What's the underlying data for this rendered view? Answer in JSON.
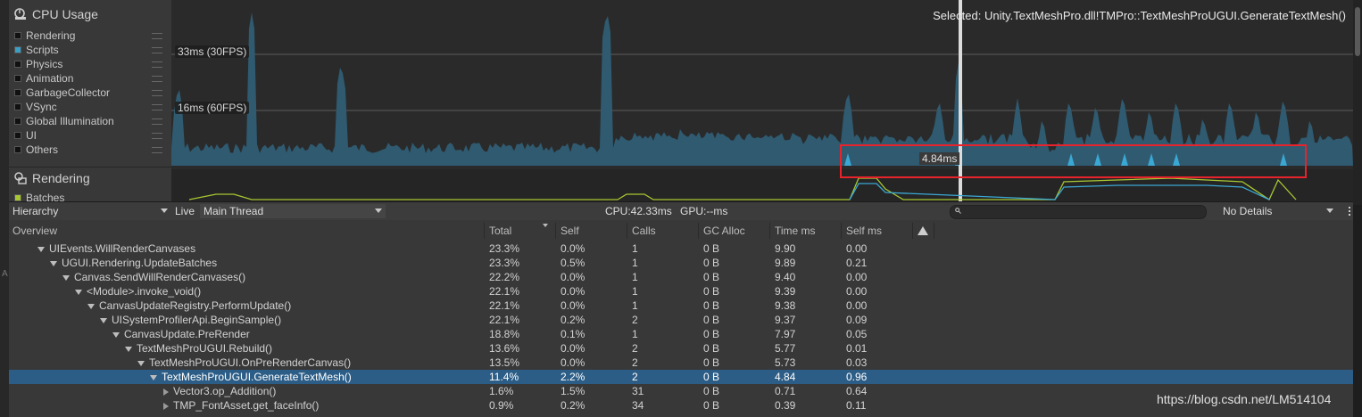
{
  "modules": {
    "cpu": {
      "title": "CPU Usage",
      "legend": [
        {
          "label": "Rendering",
          "color": "#111111"
        },
        {
          "label": "Scripts",
          "color": "#3a9fc4"
        },
        {
          "label": "Physics",
          "color": "#111111"
        },
        {
          "label": "Animation",
          "color": "#111111"
        },
        {
          "label": "GarbageCollector",
          "color": "#111111"
        },
        {
          "label": "VSync",
          "color": "#111111"
        },
        {
          "label": "Global Illumination",
          "color": "#111111"
        },
        {
          "label": "UI",
          "color": "#111111"
        },
        {
          "label": "Others",
          "color": "#111111"
        }
      ]
    },
    "rendering": {
      "title": "Rendering",
      "legend_first": "Batches",
      "legend_color": "#a8c832"
    }
  },
  "chart": {
    "selected": "Selected: Unity.TextMeshPro.dll!TMPro::TextMeshProUGUI.GenerateTextMesh()",
    "line_33": "33ms (30FPS)",
    "line_16": "16ms (60FPS)",
    "marker_value": "4.84ms",
    "colors": {
      "area": "#2f5a70",
      "bars": "#3ba8d4",
      "cursor": "#dcdcdc",
      "highlight": "#e8232b"
    }
  },
  "toolbar": {
    "view": "Hierarchy",
    "live": "Live",
    "thread": "Main Thread",
    "cpu": "CPU:42.33ms",
    "gpu": "GPU:--ms",
    "details": "No Details"
  },
  "table": {
    "headers": {
      "overview": "Overview",
      "total": "Total",
      "self": "Self",
      "calls": "Calls",
      "gc": "GC Alloc",
      "time": "Time ms",
      "selfms": "Self ms"
    },
    "rows": [
      {
        "name": "UIEvents.WillRenderCanvases",
        "depth": 0,
        "expanded": true,
        "total": "23.3%",
        "self": "0.0%",
        "calls": "1",
        "gc": "0 B",
        "time": "9.90",
        "selfms": "0.00"
      },
      {
        "name": "UGUI.Rendering.UpdateBatches",
        "depth": 1,
        "expanded": true,
        "total": "23.3%",
        "self": "0.5%",
        "calls": "1",
        "gc": "0 B",
        "time": "9.89",
        "selfms": "0.21"
      },
      {
        "name": "Canvas.SendWillRenderCanvases()",
        "depth": 2,
        "expanded": true,
        "total": "22.2%",
        "self": "0.0%",
        "calls": "1",
        "gc": "0 B",
        "time": "9.40",
        "selfms": "0.00"
      },
      {
        "name": "<Module>.invoke_void()",
        "depth": 3,
        "expanded": true,
        "total": "22.1%",
        "self": "0.0%",
        "calls": "1",
        "gc": "0 B",
        "time": "9.39",
        "selfms": "0.00"
      },
      {
        "name": "CanvasUpdateRegistry.PerformUpdate()",
        "depth": 4,
        "expanded": true,
        "total": "22.1%",
        "self": "0.0%",
        "calls": "1",
        "gc": "0 B",
        "time": "9.38",
        "selfms": "0.00"
      },
      {
        "name": "UISystemProfilerApi.BeginSample()",
        "depth": 5,
        "expanded": true,
        "total": "22.1%",
        "self": "0.2%",
        "calls": "2",
        "gc": "0 B",
        "time": "9.37",
        "selfms": "0.09"
      },
      {
        "name": "CanvasUpdate.PreRender",
        "depth": 6,
        "expanded": true,
        "total": "18.8%",
        "self": "0.1%",
        "calls": "1",
        "gc": "0 B",
        "time": "7.97",
        "selfms": "0.05"
      },
      {
        "name": "TextMeshProUGUI.Rebuild()",
        "depth": 7,
        "expanded": true,
        "total": "13.6%",
        "self": "0.0%",
        "calls": "2",
        "gc": "0 B",
        "time": "5.77",
        "selfms": "0.01"
      },
      {
        "name": "TextMeshProUGUI.OnPreRenderCanvas()",
        "depth": 8,
        "expanded": true,
        "total": "13.5%",
        "self": "0.0%",
        "calls": "2",
        "gc": "0 B",
        "time": "5.73",
        "selfms": "0.03"
      },
      {
        "name": "TextMeshProUGUI.GenerateTextMesh()",
        "depth": 9,
        "expanded": true,
        "selected": true,
        "total": "11.4%",
        "self": "2.2%",
        "calls": "2",
        "gc": "0 B",
        "time": "4.84",
        "selfms": "0.96"
      },
      {
        "name": "Vector3.op_Addition()",
        "depth": 10,
        "expanded": false,
        "total": "1.6%",
        "self": "1.5%",
        "calls": "31",
        "gc": "0 B",
        "time": "0.71",
        "selfms": "0.64"
      },
      {
        "name": "TMP_FontAsset.get_faceInfo()",
        "depth": 10,
        "expanded": false,
        "total": "0.9%",
        "self": "0.2%",
        "calls": "34",
        "gc": "0 B",
        "time": "0.39",
        "selfms": "0.11"
      }
    ]
  },
  "watermark": "https://blog.csdn.net/LM514104"
}
